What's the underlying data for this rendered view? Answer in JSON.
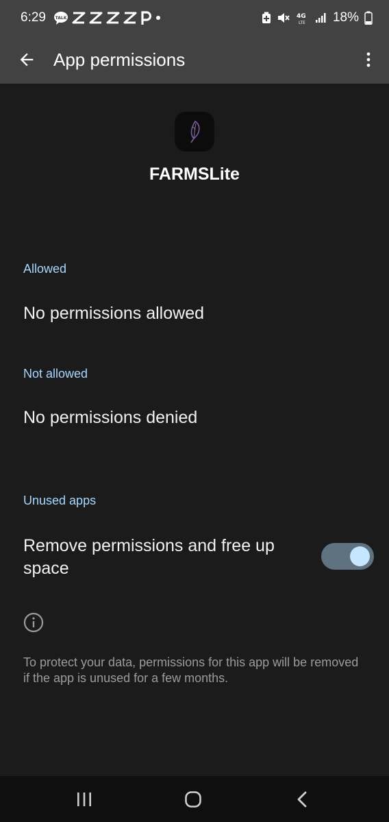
{
  "status_bar": {
    "time": "6:29",
    "left_icons": [
      "talk-icon",
      "capcut-icon",
      "capcut-icon",
      "capcut-icon",
      "capcut-icon",
      "p-icon",
      "dot-icon"
    ],
    "right_icons": [
      "battery-saver-icon",
      "mute-icon",
      "4g-lte-icon",
      "signal-icon",
      "battery-icon"
    ],
    "battery": "18%",
    "background_color": "#424242"
  },
  "app_bar": {
    "back_icon": "arrow-back-icon",
    "title": "App permissions",
    "menu_icon": "more-vert-icon"
  },
  "header": {
    "app_icon": "feather-icon",
    "app_name": "FARMSLite"
  },
  "sections": {
    "allowed": {
      "label": "Allowed",
      "item": "No permissions allowed"
    },
    "not_allowed": {
      "label": "Not allowed",
      "item": "No permissions denied"
    },
    "unused_apps": {
      "label": "Unused apps",
      "toggle_label": "Remove permissions and free up space",
      "toggle_on": true
    }
  },
  "footer": {
    "info_icon": "info-icon",
    "text": "To protect your data, permissions for this app will be removed if the app is unused for a few months."
  },
  "nav_bar": {
    "items": [
      "recents-icon",
      "home-icon",
      "back-icon"
    ]
  },
  "colors": {
    "background": "#1b1b1b",
    "accent": "#a7d7ff",
    "toggle_track": "#5f7280",
    "toggle_knob": "#c6e6ff"
  }
}
